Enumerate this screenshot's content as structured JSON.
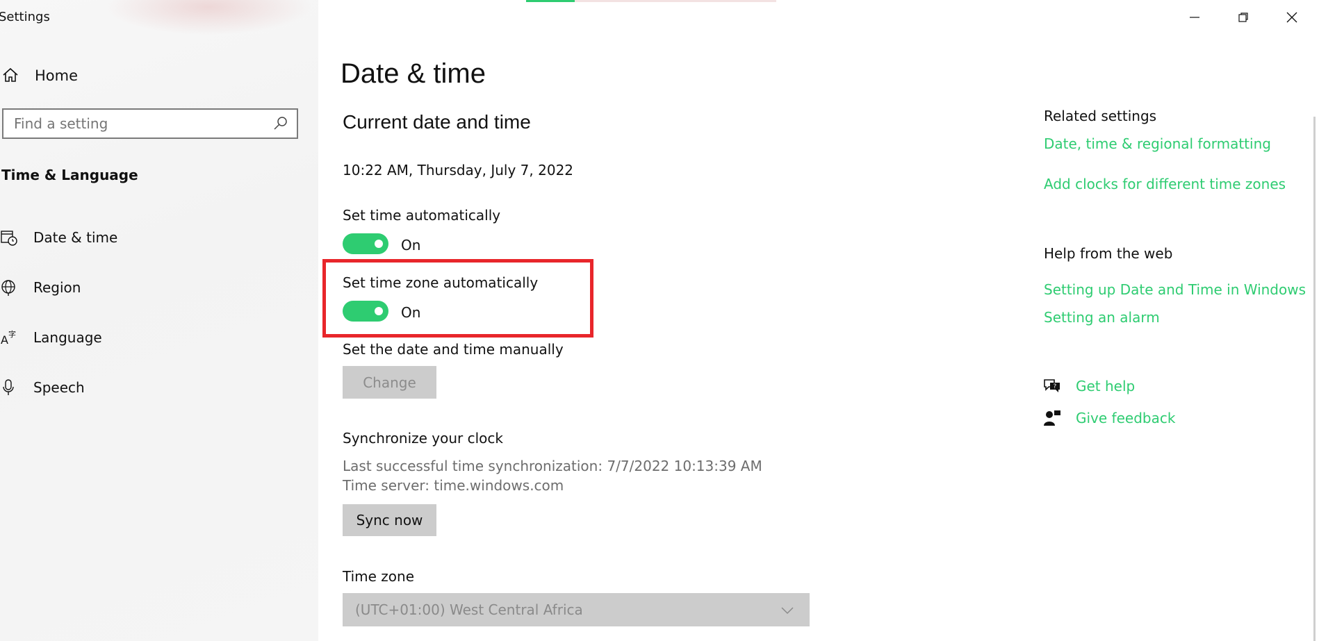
{
  "app": {
    "title": "Settings"
  },
  "sidebar": {
    "home_label": "Home",
    "search_placeholder": "Find a setting",
    "section_title": "Time & Language",
    "items": [
      {
        "label": "Date & time",
        "icon": "calendar-clock-icon"
      },
      {
        "label": "Region",
        "icon": "globe-icon"
      },
      {
        "label": "Language",
        "icon": "language-icon"
      },
      {
        "label": "Speech",
        "icon": "microphone-icon"
      }
    ]
  },
  "page": {
    "title": "Date & time",
    "section_current": "Current date and time",
    "current_datetime": "10:22 AM, Thursday, July 7, 2022",
    "set_time_auto": {
      "label": "Set time automatically",
      "state": "On"
    },
    "set_timezone_auto": {
      "label": "Set time zone automatically",
      "state": "On"
    },
    "manual": {
      "label": "Set the date and time manually",
      "button": "Change"
    },
    "sync": {
      "title": "Synchronize your clock",
      "last_sync": "Last successful time synchronization: 7/7/2022 10:13:39 AM",
      "server": "Time server: time.windows.com",
      "button": "Sync now"
    },
    "timezone": {
      "label": "Time zone",
      "value": "(UTC+01:00) West Central Africa"
    }
  },
  "related": {
    "title": "Related settings",
    "links": [
      "Date, time & regional formatting",
      "Add clocks for different time zones"
    ]
  },
  "help_web": {
    "title": "Help from the web",
    "links": [
      "Setting up Date and Time in Windows",
      "Setting an alarm"
    ]
  },
  "support": {
    "get_help": "Get help",
    "give_feedback": "Give feedback"
  },
  "colors": {
    "accent": "#2ecc71",
    "highlight": "#e8262b"
  }
}
